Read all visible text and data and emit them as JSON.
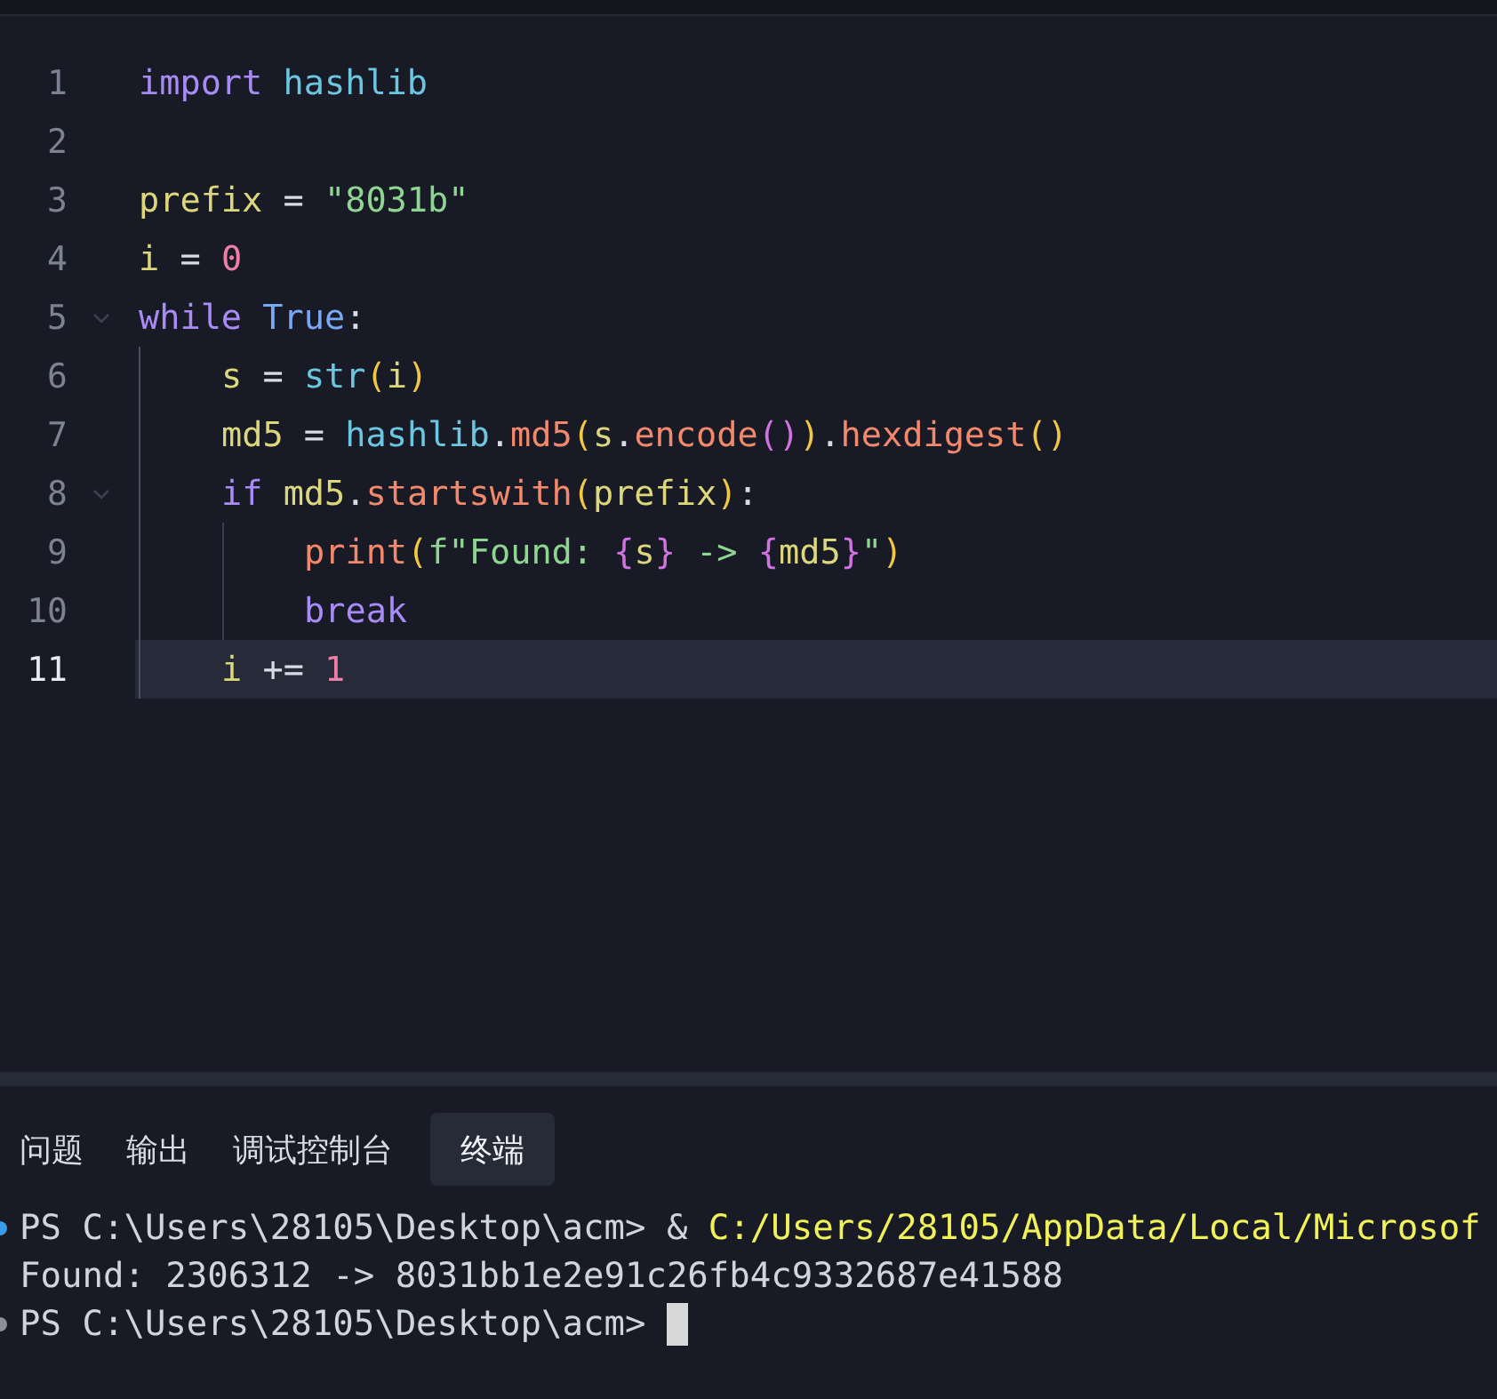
{
  "editor": {
    "lines": [
      {
        "number": "1",
        "active": false,
        "foldable": false,
        "tokens": [
          {
            "text": "import ",
            "kind": "keyword"
          },
          {
            "text": "hashlib",
            "kind": "module"
          }
        ]
      },
      {
        "number": "2",
        "active": false,
        "foldable": false
      },
      {
        "number": "3",
        "active": false,
        "foldable": false,
        "tokens": [
          {
            "text": "prefix",
            "kind": "variable"
          },
          {
            "text": " = ",
            "kind": "plain"
          },
          {
            "text": "\"8031b\"",
            "kind": "string"
          }
        ]
      },
      {
        "number": "4",
        "active": false,
        "foldable": false,
        "tokens": [
          {
            "text": "i",
            "kind": "variable"
          },
          {
            "text": " = ",
            "kind": "plain"
          },
          {
            "text": "0",
            "kind": "number"
          }
        ]
      },
      {
        "number": "5",
        "active": false,
        "foldable": true,
        "tokens": [
          {
            "text": "while ",
            "kind": "keyword"
          },
          {
            "text": "True",
            "kind": "constant"
          },
          {
            "text": ":",
            "kind": "plain"
          }
        ],
        "children": [
          {
            "number": "6",
            "active": false,
            "foldable": false,
            "tokens": [
              {
                "text": "s",
                "kind": "variable"
              },
              {
                "text": " = ",
                "kind": "plain"
              },
              {
                "text": "str",
                "kind": "module"
              },
              {
                "text": "(",
                "kind": "bracket1"
              },
              {
                "text": "i",
                "kind": "variable"
              },
              {
                "text": ")",
                "kind": "bracket1"
              }
            ]
          },
          {
            "number": "7",
            "active": false,
            "foldable": false,
            "tokens": [
              {
                "text": "md5",
                "kind": "variable"
              },
              {
                "text": " = ",
                "kind": "plain"
              },
              {
                "text": "hashlib",
                "kind": "module"
              },
              {
                "text": ".",
                "kind": "plain"
              },
              {
                "text": "md5",
                "kind": "function"
              },
              {
                "text": "(",
                "kind": "bracket1"
              },
              {
                "text": "s",
                "kind": "variable"
              },
              {
                "text": ".",
                "kind": "plain"
              },
              {
                "text": "encode",
                "kind": "function"
              },
              {
                "text": "()",
                "kind": "bracket2"
              },
              {
                "text": ")",
                "kind": "bracket1"
              },
              {
                "text": ".",
                "kind": "plain"
              },
              {
                "text": "hexdigest",
                "kind": "function"
              },
              {
                "text": "()",
                "kind": "bracket1"
              }
            ]
          },
          {
            "number": "8",
            "active": false,
            "foldable": true,
            "tokens": [
              {
                "text": "if ",
                "kind": "keyword"
              },
              {
                "text": "md5",
                "kind": "variable"
              },
              {
                "text": ".",
                "kind": "plain"
              },
              {
                "text": "startswith",
                "kind": "function"
              },
              {
                "text": "(",
                "kind": "bracket1"
              },
              {
                "text": "prefix",
                "kind": "variable"
              },
              {
                "text": ")",
                "kind": "bracket1"
              },
              {
                "text": ":",
                "kind": "plain"
              }
            ],
            "children": [
              {
                "number": "9",
                "active": false,
                "foldable": false,
                "tokens": [
                  {
                    "text": "print",
                    "kind": "function"
                  },
                  {
                    "text": "(",
                    "kind": "bracket1"
                  },
                  {
                    "text": "f\"Found: ",
                    "kind": "string"
                  },
                  {
                    "text": "{",
                    "kind": "bracket2"
                  },
                  {
                    "text": "s",
                    "kind": "variable"
                  },
                  {
                    "text": "}",
                    "kind": "bracket2"
                  },
                  {
                    "text": " -> ",
                    "kind": "string"
                  },
                  {
                    "text": "{",
                    "kind": "bracket2"
                  },
                  {
                    "text": "md5",
                    "kind": "variable"
                  },
                  {
                    "text": "}",
                    "kind": "bracket2"
                  },
                  {
                    "text": "\"",
                    "kind": "string"
                  },
                  {
                    "text": ")",
                    "kind": "bracket1"
                  }
                ]
              },
              {
                "number": "10",
                "active": false,
                "foldable": false,
                "tokens": [
                  {
                    "text": "break",
                    "kind": "keyword"
                  }
                ]
              }
            ]
          },
          {
            "number": "11",
            "active": true,
            "foldable": false,
            "tokens": [
              {
                "text": "i",
                "kind": "variable"
              },
              {
                "text": " += ",
                "kind": "plain"
              },
              {
                "text": "1",
                "kind": "number"
              }
            ]
          }
        ]
      }
    ]
  },
  "panel": {
    "tabs": [
      {
        "label": "问题",
        "selected": false
      },
      {
        "label": "输出",
        "selected": false
      },
      {
        "label": "调试控制台",
        "selected": false
      },
      {
        "label": "终端",
        "selected": true
      }
    ],
    "terminal": [
      {
        "color": "#3a9ce8",
        "cursor": false,
        "segments": [
          {
            "text": "PS C:\\Users\\28105\\Desktop\\acm> & ",
            "kind": "plain"
          },
          {
            "text": "C:/Users/28105/AppData/Local/Microsof",
            "kind": "path"
          }
        ]
      },
      {
        "cursor": false,
        "segments": [
          {
            "text": "Found: 2306312 -> 8031bb1e2e91c26fb4c9332687e41588",
            "kind": "plain"
          }
        ]
      },
      {
        "color": "#8a8f99",
        "cursor": true,
        "segments": [
          {
            "text": "PS C:\\Users\\28105\\Desktop\\acm> ",
            "kind": "plain"
          }
        ]
      }
    ]
  }
}
